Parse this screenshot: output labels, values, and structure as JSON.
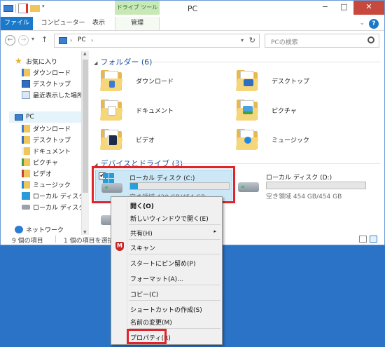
{
  "window": {
    "title": "PC",
    "context_tab_group": "ドライブ ツール",
    "minimize": "−",
    "maximize": "□",
    "close": "✕"
  },
  "ribbon": {
    "tabs": [
      {
        "label": "ファイル"
      },
      {
        "label": "コンピューター"
      },
      {
        "label": "表示"
      },
      {
        "label": "管理"
      }
    ],
    "help": "?",
    "expand": "⌄"
  },
  "address": {
    "back": "←",
    "forward": "→",
    "dropdown": "▾",
    "up": "↑",
    "crumb_sep": "›",
    "location": "PC",
    "refresh": "↻",
    "search_placeholder": "PCの検索"
  },
  "nav_pane": {
    "favorites": {
      "label": "お気に入り",
      "items": [
        "ダウンロード",
        "デスクトップ",
        "最近表示した場所"
      ]
    },
    "pc": {
      "label": "PC",
      "items": [
        "ダウンロード",
        "デスクトップ",
        "ドキュメント",
        "ピクチャ",
        "ビデオ",
        "ミュージック",
        "ローカル ディスク (C:",
        "ローカル ディスク (D"
      ]
    },
    "network": "ネットワーク"
  },
  "content": {
    "folders_header": "フォルダー (6)",
    "folders": [
      "ダウンロード",
      "デスクトップ",
      "ドキュメント",
      "ピクチャ",
      "ビデオ",
      "ミュージック"
    ],
    "devices_header": "デバイスとドライブ (3)",
    "drives": [
      {
        "name": "ローカル ディスク (C:)",
        "free": "空き領域 420 GB/454 GB",
        "used_fraction": 0.075,
        "selected": true
      },
      {
        "name": "ローカル ディスク (D:)",
        "free": "空き領域 454 GB/454 GB",
        "used_fraction": 0.0,
        "selected": false
      }
    ]
  },
  "status_bar": {
    "item_count": "9 個の項目",
    "selected_count": "1 個の項目を選択"
  },
  "context_menu": {
    "items": [
      {
        "label": "開く(O)",
        "bold": true
      },
      {
        "label": "新しいウィンドウで開く(E)"
      },
      {
        "label": "共有(H)",
        "submenu": true
      },
      {
        "label": "スキャン",
        "icon": "shield-icon"
      },
      {
        "label": "スタートにピン留め(P)"
      },
      {
        "label": "フォーマット(A)..."
      },
      {
        "label": "コピー(C)"
      },
      {
        "label": "ショートカットの作成(S)"
      },
      {
        "label": "名前の変更(M)"
      },
      {
        "label": "プロパティ(R)",
        "highlighted": true
      }
    ],
    "submenu_arrow": "▸",
    "shield_glyph": "M"
  },
  "colors": {
    "accent": "#1979ca",
    "highlight": "#e0242a",
    "desktop": "#2b73c7",
    "drive_bar": "#26a0da"
  }
}
